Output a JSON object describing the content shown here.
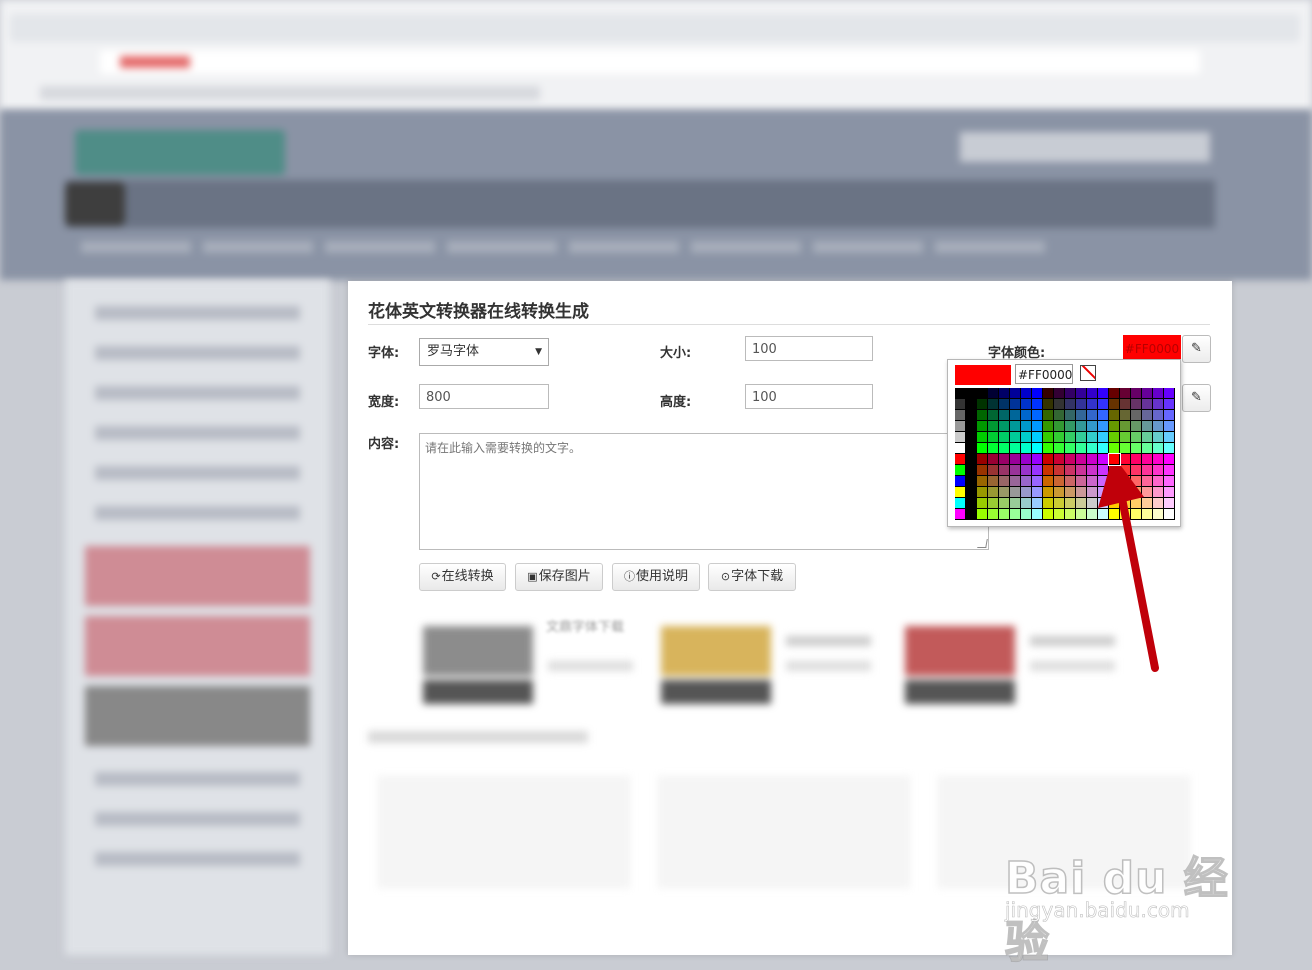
{
  "page": {
    "title": "花体英文转换器在线转换生成",
    "font_label": "字体:",
    "font_value": "罗马字体",
    "size_label": "大小:",
    "size_value": "100",
    "color_label": "字体颜色:",
    "color_value": "#FF0000",
    "width_label": "宽度:",
    "width_value": "800",
    "height_label": "高度:",
    "height_value": "100",
    "content_label": "内容:",
    "content_placeholder": "请在此输入需要转换的文字。"
  },
  "buttons": {
    "convert": "在线转换",
    "save": "保存图片",
    "help": "使用说明",
    "download": "字体下载"
  },
  "picker": {
    "hex_value": "#FF0000",
    "preview_color": "#FF0000"
  },
  "lower": {
    "card_title": "文鼎字体下载"
  },
  "watermark": {
    "brand": "Bai du 经验",
    "url": "jingyan.baidu.com"
  },
  "colors": {
    "accent_red": "#FF0000",
    "arrow": "#C0000A"
  }
}
